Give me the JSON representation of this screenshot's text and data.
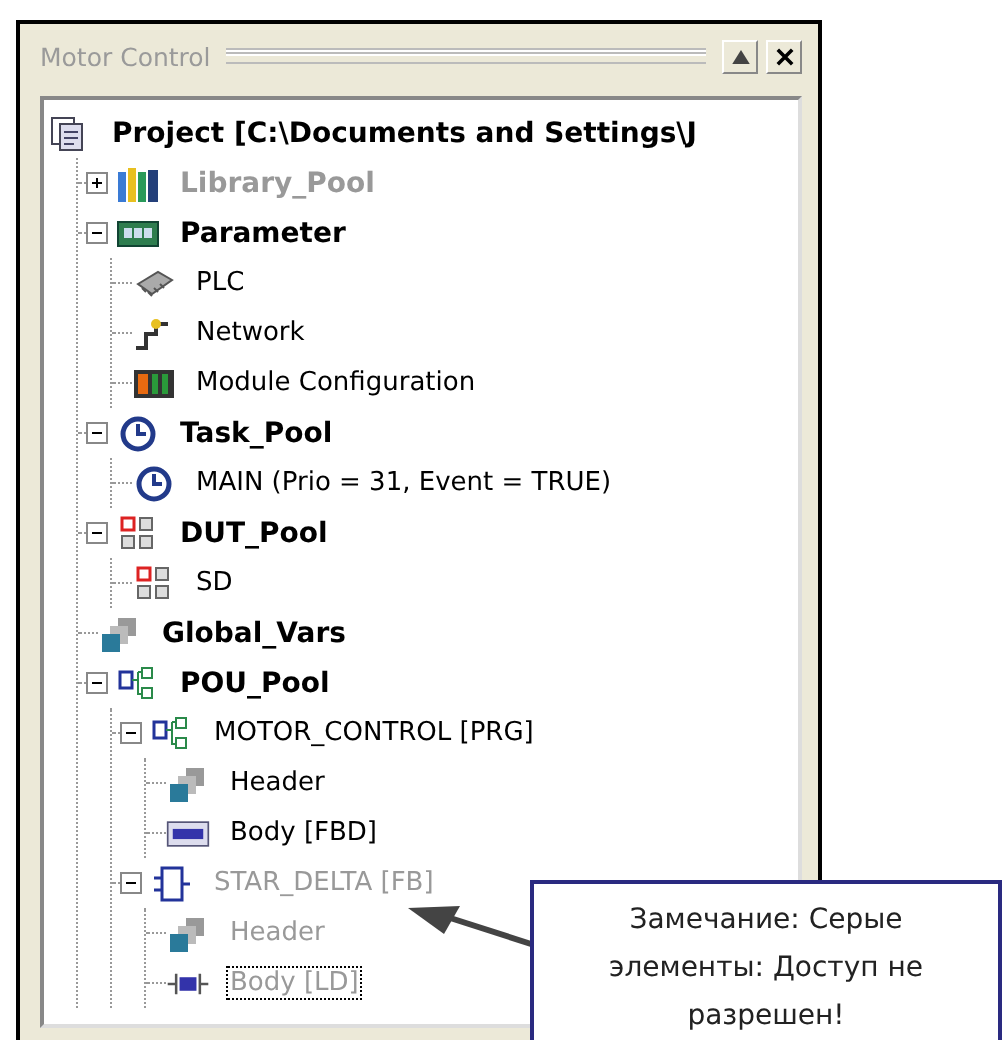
{
  "window": {
    "title": "Motor Control"
  },
  "tree": [
    {
      "label": "Project [C:\\Documents and Settings\\J",
      "kind": "project",
      "bold": true,
      "disabled": false,
      "children": [
        {
          "label": "Library_Pool",
          "kind": "library",
          "bold": true,
          "disabled": true,
          "expanded": false
        },
        {
          "label": "Parameter",
          "kind": "parameter",
          "bold": true,
          "disabled": false,
          "expanded": true,
          "children": [
            {
              "label": "PLC",
              "kind": "plc",
              "bold": false,
              "disabled": false
            },
            {
              "label": "Network",
              "kind": "network",
              "bold": false,
              "disabled": false
            },
            {
              "label": "Module Configuration",
              "kind": "module",
              "bold": false,
              "disabled": false
            }
          ]
        },
        {
          "label": "Task_Pool",
          "kind": "taskpool",
          "bold": true,
          "disabled": false,
          "expanded": true,
          "children": [
            {
              "label": "MAIN (Prio = 31, Event = TRUE)",
              "kind": "clock",
              "bold": false,
              "disabled": false
            }
          ]
        },
        {
          "label": "DUT_Pool",
          "kind": "dutpool",
          "bold": true,
          "disabled": false,
          "expanded": true,
          "children": [
            {
              "label": "SD",
              "kind": "dut",
              "bold": false,
              "disabled": false
            }
          ]
        },
        {
          "label": "Global_Vars",
          "kind": "globals",
          "bold": true,
          "disabled": false
        },
        {
          "label": "POU_Pool",
          "kind": "poupool",
          "bold": true,
          "disabled": false,
          "expanded": true,
          "children": [
            {
              "label": "MOTOR_CONTROL [PRG]",
              "kind": "program",
              "bold": false,
              "disabled": false,
              "expanded": true,
              "children": [
                {
                  "label": "Header",
                  "kind": "header",
                  "bold": false,
                  "disabled": false
                },
                {
                  "label": "Body [FBD]",
                  "kind": "fbd",
                  "bold": false,
                  "disabled": false
                }
              ]
            },
            {
              "label": "STAR_DELTA [FB]",
              "kind": "fb",
              "bold": false,
              "disabled": true,
              "expanded": true,
              "children": [
                {
                  "label": "Header",
                  "kind": "header",
                  "bold": false,
                  "disabled": true
                },
                {
                  "label": "Body [LD]",
                  "kind": "ld",
                  "bold": false,
                  "disabled": true,
                  "focused": true
                }
              ]
            }
          ]
        }
      ]
    }
  ],
  "callout": {
    "text": "Замечание: Серые элементы: Доступ не разрешен!"
  }
}
